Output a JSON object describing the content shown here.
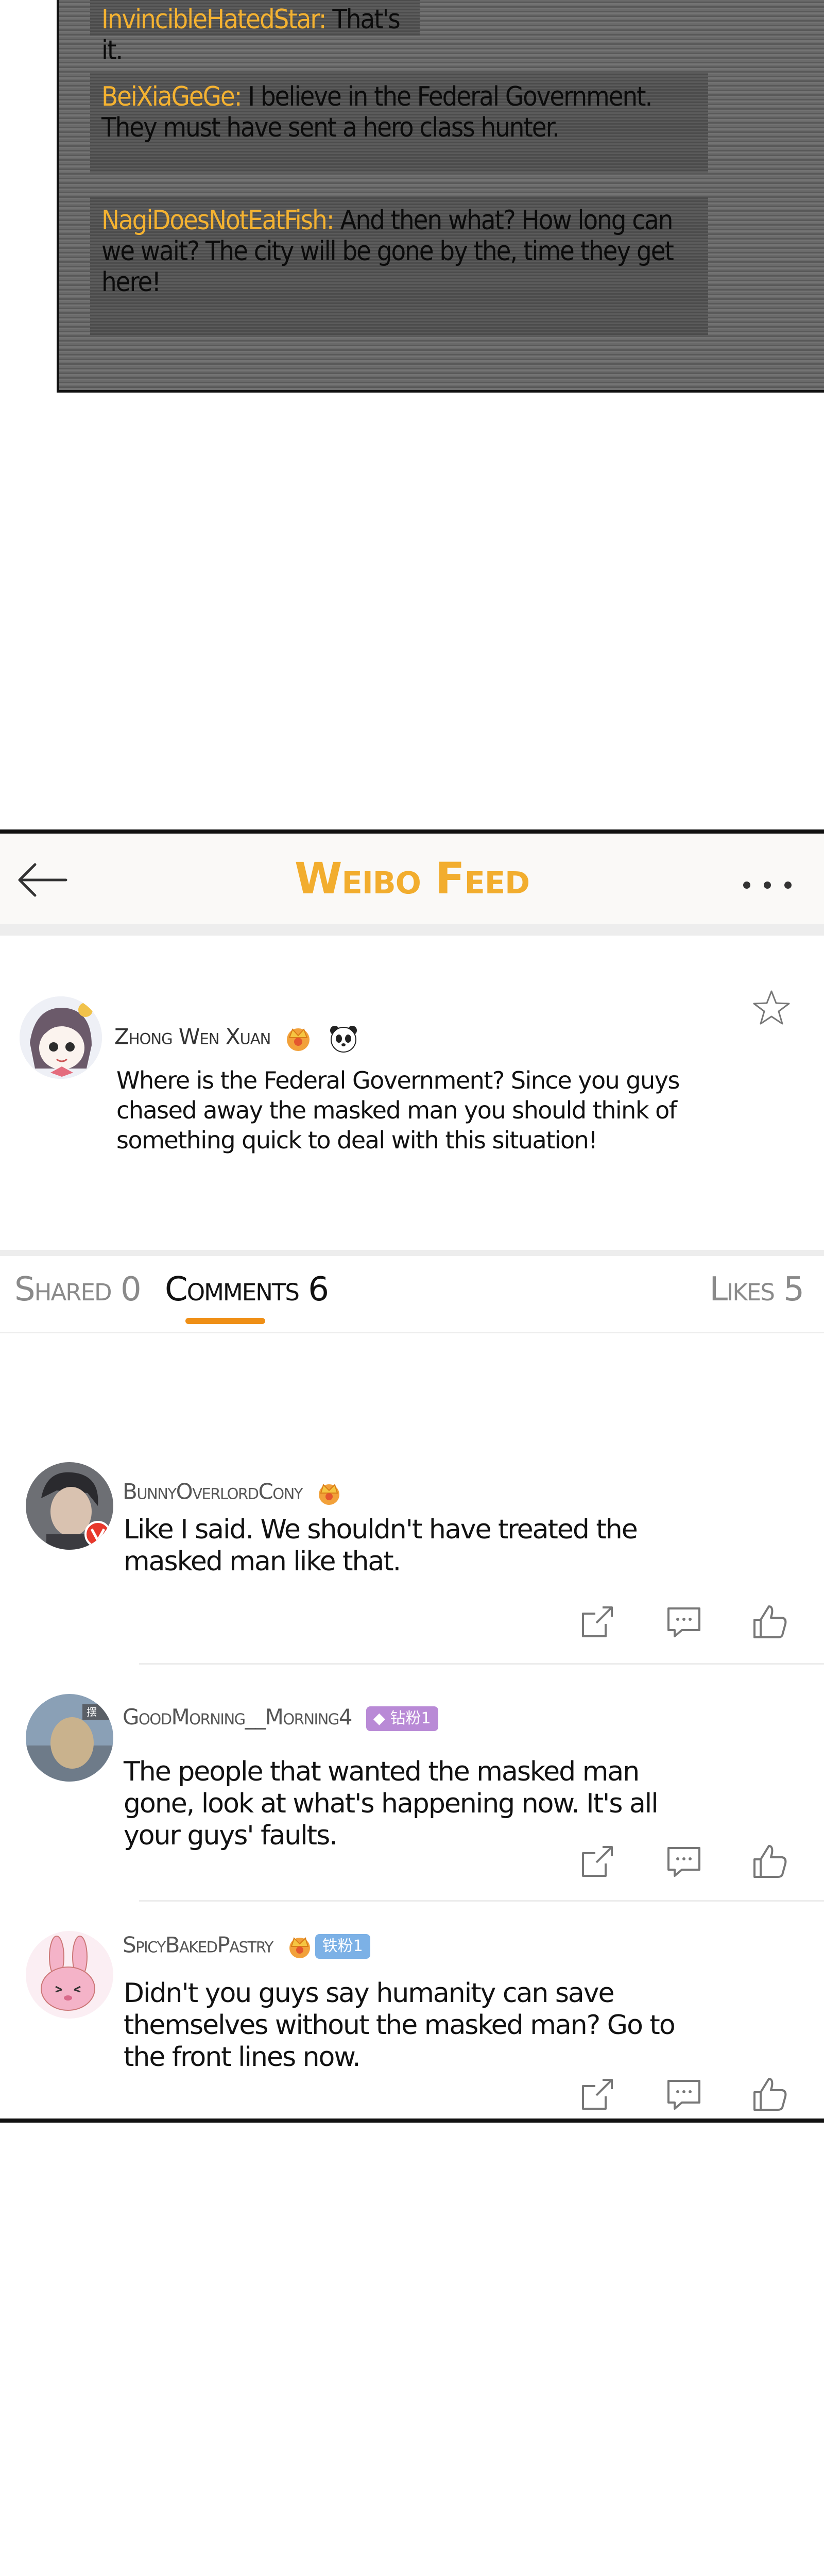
{
  "chat": {
    "messages": [
      {
        "user": "InvincibleHatedStar:",
        "text": " That's it."
      },
      {
        "user": "BeiXiaGeGe:",
        "text": " I believe in the Federal Government. They must have sent a hero class hunter."
      },
      {
        "user": "NagiDoesNotEatFish:",
        "text": " And then what? How long can we wait? The city will be gone by the, time they get here!"
      }
    ]
  },
  "header": {
    "title": "Weibo Feed",
    "back_icon": "arrow-left-icon",
    "more_icon": "more-dots-icon"
  },
  "post": {
    "username": "Zhong Wen Xuan",
    "text": "Where is the Federal Government? Since you guys chased away the masked man you should think of something quick to deal with this situation!",
    "favorite_icon": "star-icon"
  },
  "tabs": {
    "shared": "Shared 0",
    "comments": "Comments 6",
    "likes": "Likes 5",
    "active": "comments"
  },
  "comments": [
    {
      "username": "BunnyOverlordCony",
      "badge": "",
      "text": "Like I said. We shouldn't have treated the masked man like that."
    },
    {
      "username": "GoodMorning__Morning4",
      "badge": "钻粉1",
      "text": "The people that wanted the masked man gone, look at what's happening now. It's all your guys' faults."
    },
    {
      "username": "SpicyBakedPastry",
      "badge": "铁粉1",
      "text": "Didn't you guys say humanity can save themselves without the masked man? Go to the front lines now."
    }
  ],
  "colors": {
    "accent": "#f2ad2e",
    "username_chat": "#f4b231",
    "tab_underline": "#ef8f16",
    "fan_purple": "#b98ad6",
    "fan_blue": "#7cb1e6"
  }
}
